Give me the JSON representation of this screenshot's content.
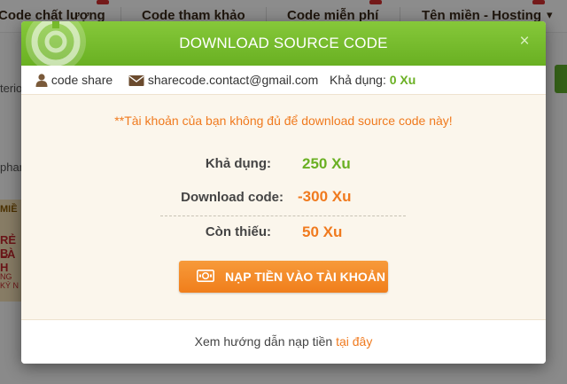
{
  "background": {
    "nav": [
      {
        "label": "Code chất lượng"
      },
      {
        "label": "Code tham khảo"
      },
      {
        "label": "Code miễn phí"
      },
      {
        "label": "Tên miền - Hosting"
      }
    ],
    "side_texts": [
      "terior",
      "phan"
    ],
    "banner": {
      "line0": "MIỀ",
      "line1": "RẺ B",
      "line2": "LÀ H",
      "line3": "NG KÝ N"
    }
  },
  "modal": {
    "title": "DOWNLOAD SOURCE CODE",
    "close_icon": "×",
    "info": {
      "user": "code share",
      "email": "sharecode.contact@gmail.com",
      "balance_label": "Khả dụng:",
      "balance_value": "0 Xu"
    },
    "warning": "**Tài khoản của bạn không đủ để download source code này!",
    "rows": [
      {
        "label": "Khả dụng:",
        "value": "250 Xu"
      },
      {
        "label": "Download code:",
        "value": "-300 Xu"
      },
      {
        "label": "Còn thiếu:",
        "value": "50 Xu"
      }
    ],
    "topup_button": "NẠP TIỀN VÀO TÀI KHOẢN",
    "footer": {
      "text": "Xem hướng dẫn nạp tiền ",
      "link": "tại đây"
    }
  },
  "colors": {
    "header_green": "#75b92a",
    "accent_orange": "#f07a1e",
    "value_green": "#6ab023"
  },
  "icons": [
    "logo-icon",
    "close-icon",
    "user-icon",
    "envelope-icon",
    "money-icon"
  ]
}
